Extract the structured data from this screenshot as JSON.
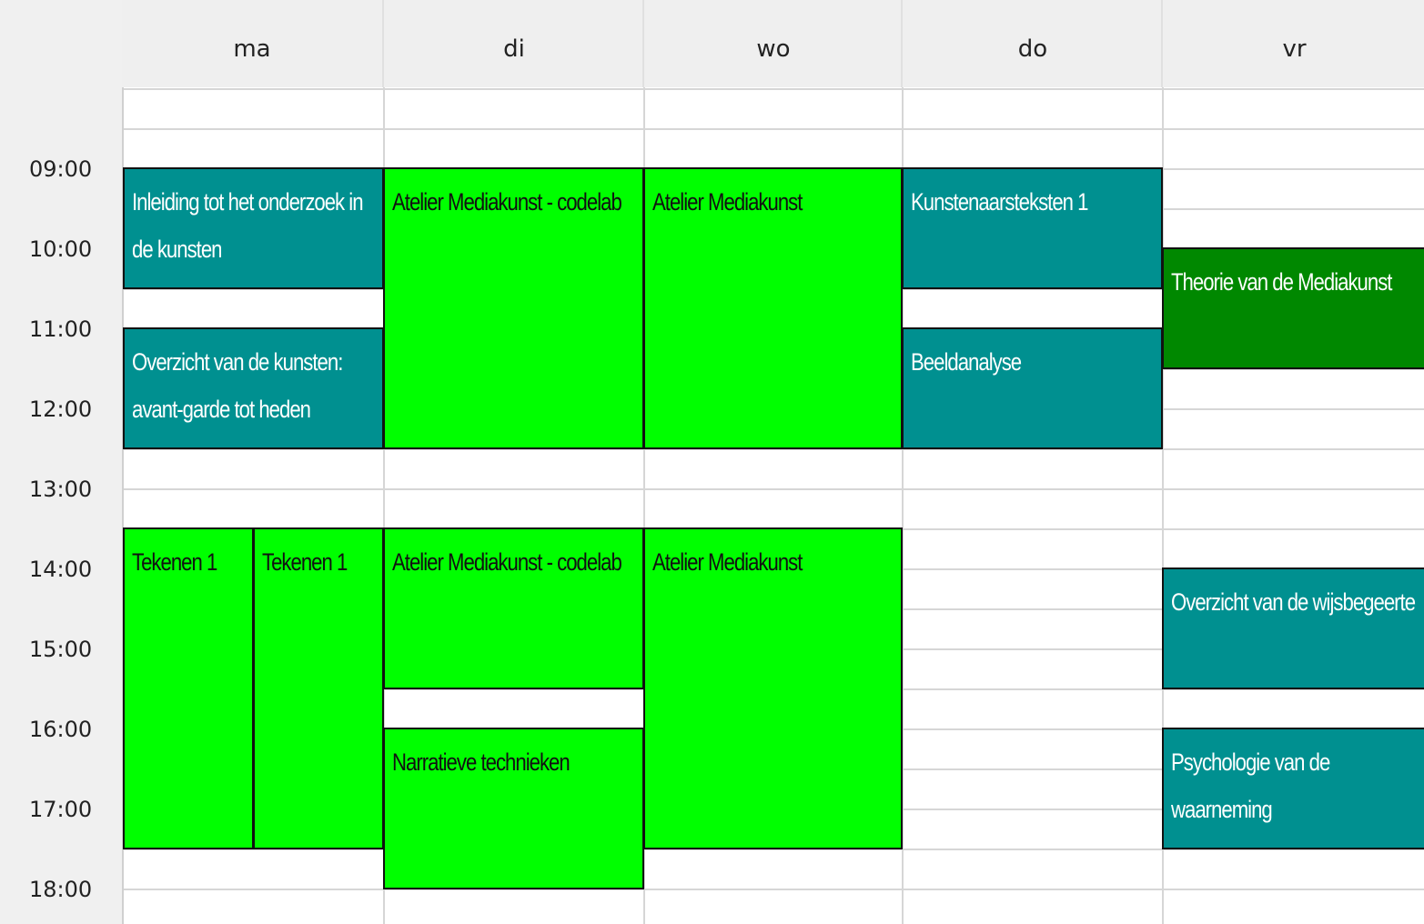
{
  "days": [
    "ma",
    "di",
    "wo",
    "do",
    "vr"
  ],
  "times": [
    "09:00",
    "10:00",
    "11:00",
    "12:00",
    "13:00",
    "14:00",
    "15:00",
    "16:00",
    "17:00",
    "18:00"
  ],
  "colors": {
    "teal": "#009090",
    "lime": "#00ff00",
    "dark_green": "#008800"
  },
  "events": [
    {
      "title": "Inleiding tot het onderzoek in de kunsten",
      "day": "ma",
      "start": "09:00",
      "end": "10:30",
      "color": "teal"
    },
    {
      "title": "Overzicht van de kunsten: avant-garde tot heden",
      "day": "ma",
      "start": "11:00",
      "end": "12:30",
      "color": "teal"
    },
    {
      "title": "Tekenen 1",
      "day": "ma",
      "start": "13:30",
      "end": "17:30",
      "color": "lime"
    },
    {
      "title": "Tekenen 1",
      "day": "ma",
      "start": "13:30",
      "end": "17:30",
      "color": "lime"
    },
    {
      "title": "Atelier Mediakunst - codelab",
      "day": "di",
      "start": "09:00",
      "end": "12:30",
      "color": "lime"
    },
    {
      "title": "Atelier Mediakunst - codelab",
      "day": "di",
      "start": "13:30",
      "end": "15:30",
      "color": "lime"
    },
    {
      "title": "Narratieve technieken",
      "day": "di",
      "start": "16:00",
      "end": "18:00",
      "color": "lime"
    },
    {
      "title": "Atelier Mediakunst",
      "day": "wo",
      "start": "09:00",
      "end": "12:30",
      "color": "lime"
    },
    {
      "title": "Atelier Mediakunst",
      "day": "wo",
      "start": "13:30",
      "end": "17:30",
      "color": "lime"
    },
    {
      "title": "Kunstenaarsteksten 1",
      "day": "do",
      "start": "09:00",
      "end": "10:30",
      "color": "teal"
    },
    {
      "title": "Beeldanalyse",
      "day": "do",
      "start": "11:00",
      "end": "12:30",
      "color": "teal"
    },
    {
      "title": "Theorie van de Mediakunst",
      "day": "vr",
      "start": "10:00",
      "end": "11:30",
      "color": "dark_green"
    },
    {
      "title": "Overzicht van de wijsbegeerte",
      "day": "vr",
      "start": "14:00",
      "end": "15:30",
      "color": "teal"
    },
    {
      "title": "Psychologie van de waarneming",
      "day": "vr",
      "start": "16:00",
      "end": "17:30",
      "color": "teal"
    }
  ]
}
